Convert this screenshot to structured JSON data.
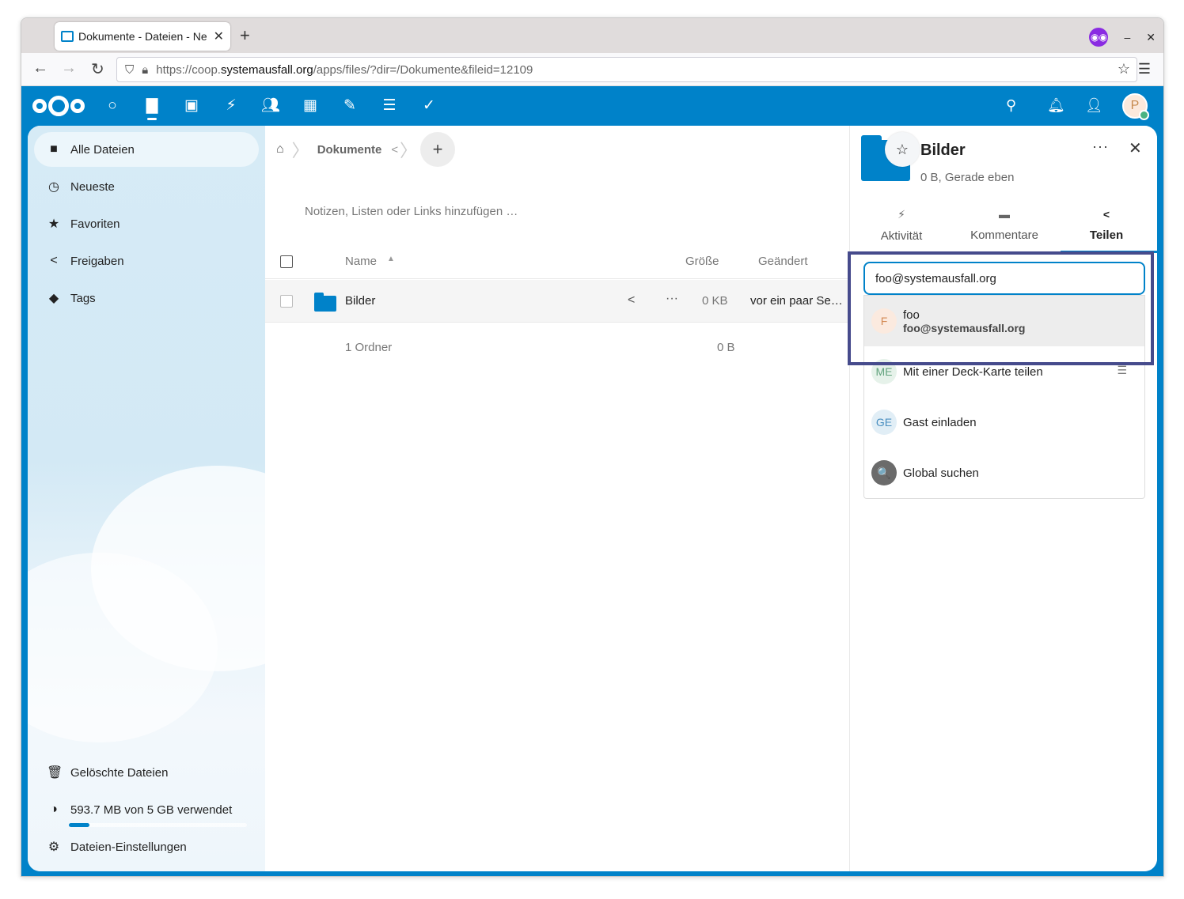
{
  "browser": {
    "tab_title": "Dokumente - Dateien - Ne",
    "tab_close": "✕",
    "new_tab": "+",
    "url_prefix": "https://coop.",
    "url_host": "systemausfall.org",
    "url_path": "/apps/files/?dir=/Dokumente&fileid=12109",
    "minimize": "–",
    "close": "✕"
  },
  "header": {
    "avatar_letter": "P"
  },
  "sidebar": {
    "items": [
      {
        "label": "Alle Dateien",
        "icon": "folder-icon"
      },
      {
        "label": "Neueste",
        "icon": "clock-icon"
      },
      {
        "label": "Favoriten",
        "icon": "star-icon"
      },
      {
        "label": "Freigaben",
        "icon": "share-icon"
      },
      {
        "label": "Tags",
        "icon": "tag-icon"
      }
    ],
    "trash_label": "Gelöschte Dateien",
    "quota_label": "593.7 MB von 5 GB verwendet",
    "quota_fraction": 0.116,
    "settings_label": "Dateien-Einstellungen"
  },
  "files": {
    "breadcrumb": "Dokumente",
    "add_label": "+",
    "notes_placeholder": "Notizen, Listen oder Links hinzufügen …",
    "columns": {
      "name": "Name",
      "size": "Größe",
      "modified": "Geändert"
    },
    "rows": [
      {
        "name": "Bilder",
        "size": "0 KB",
        "modified": "vor ein paar Se…"
      }
    ],
    "summary_count": "1 Ordner",
    "summary_size": "0 B"
  },
  "details": {
    "title": "Bilder",
    "subtitle": "0 B, Gerade eben",
    "tabs": [
      {
        "label": "Aktivität",
        "icon": "activity-icon"
      },
      {
        "label": "Kommentare",
        "icon": "comment-icon"
      },
      {
        "label": "Teilen",
        "icon": "share-icon"
      }
    ],
    "share_input_value": "foo@systemausfall.org",
    "suggestions": [
      {
        "avatar": "F",
        "label": "foo",
        "sub": "foo@systemausfall.org"
      },
      {
        "avatar": "ME",
        "label": "Mit einer Deck-Karte teilen"
      },
      {
        "avatar": "GE",
        "label": "Gast einladen"
      },
      {
        "avatar": "🔍",
        "label": "Global suchen"
      }
    ]
  },
  "colors": {
    "brand": "#0082c9",
    "highlight_frame": "#464b8c"
  }
}
